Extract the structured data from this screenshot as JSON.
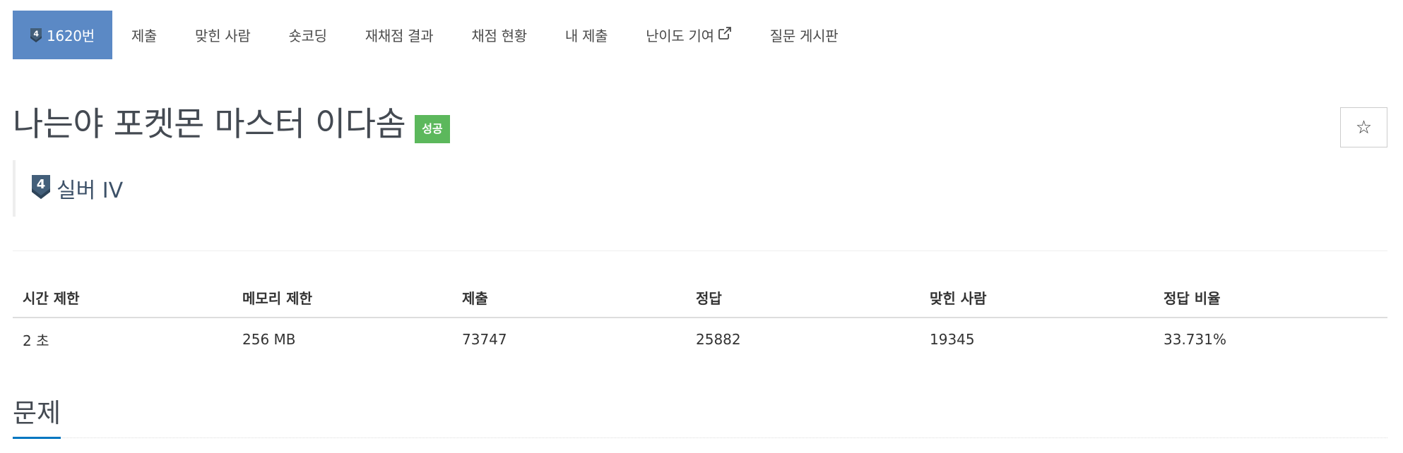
{
  "tabs": [
    {
      "label": "1620번",
      "active": true
    },
    {
      "label": "제출"
    },
    {
      "label": "맞힌 사람"
    },
    {
      "label": "숏코딩"
    },
    {
      "label": "재채점 결과"
    },
    {
      "label": "채점 현황"
    },
    {
      "label": "내 제출"
    },
    {
      "label": "난이도 기여"
    },
    {
      "label": "질문 게시판"
    }
  ],
  "tier_icon": {
    "name": "silver-4-tier-icon",
    "number": "4",
    "color": "#435f7a"
  },
  "problem": {
    "title": "나는야 포켓몬 마스터 이다솜",
    "result_badge": "성공",
    "result_color": "#5cb85c",
    "tier_label": "실버 IV",
    "star_symbol": "☆"
  },
  "info": {
    "headers": [
      "시간 제한",
      "메모리 제한",
      "제출",
      "정답",
      "맞힌 사람",
      "정답 비율"
    ],
    "values": [
      "2 초",
      "256 MB",
      "73747",
      "25882",
      "19345",
      "33.731%"
    ]
  },
  "section": {
    "title": "문제"
  },
  "colors": {
    "active_tab": "#5b89c5",
    "accent": "#0076c0"
  }
}
